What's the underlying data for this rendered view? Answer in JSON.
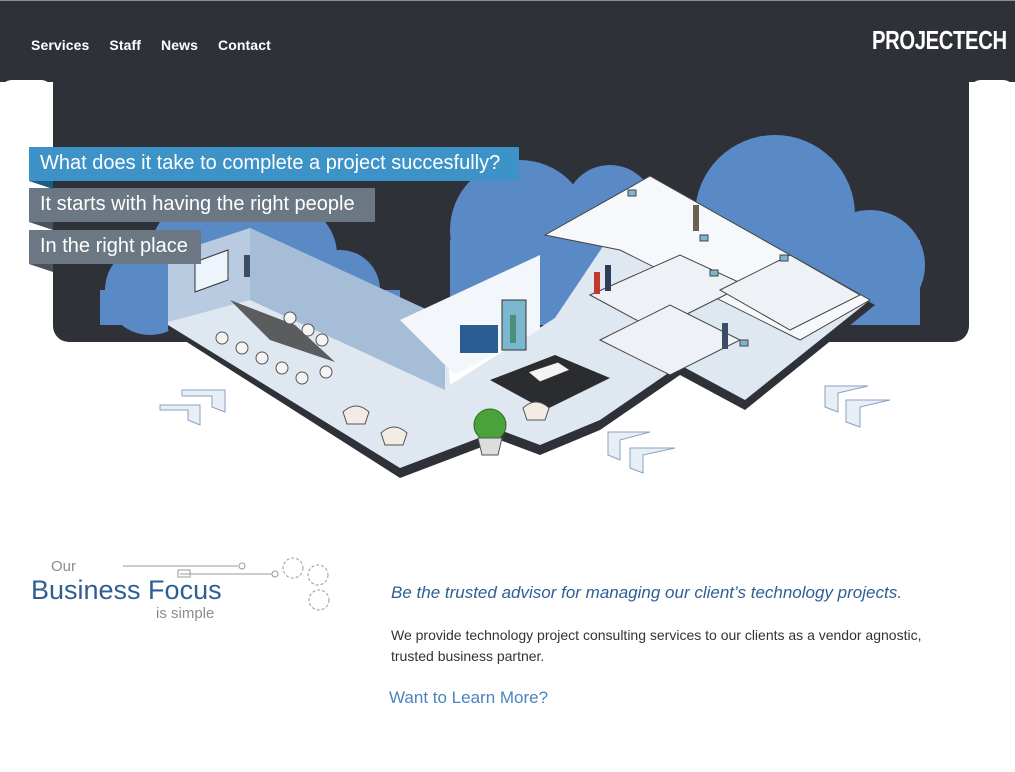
{
  "nav": {
    "items": [
      {
        "label": "Services"
      },
      {
        "label": "Staff"
      },
      {
        "label": "News"
      },
      {
        "label": "Contact"
      }
    ]
  },
  "brand": {
    "logo_text": "PROJECTECH"
  },
  "hero": {
    "callouts": [
      "What does it take to complete a project succesfully?",
      "It starts with having the right people",
      "In the right place"
    ],
    "sign_text": "PROJECTECH"
  },
  "focus": {
    "our": "Our",
    "title": "Business Focus",
    "simple": "is simple"
  },
  "content": {
    "tagline": "Be the trusted advisor for managing our client’s technology projects.",
    "description": "We provide technology project consulting services to our clients as a vendor agnostic, trusted business partner.",
    "learn_more": "Want to Learn More?"
  },
  "colors": {
    "header_bg": "#2f3139",
    "accent_blue": "#3d93c8",
    "callout_gray": "#6b7884",
    "focus_blue": "#2e5f93",
    "link_blue": "#4a84c0",
    "cloud_blue": "#5a8ac6"
  }
}
